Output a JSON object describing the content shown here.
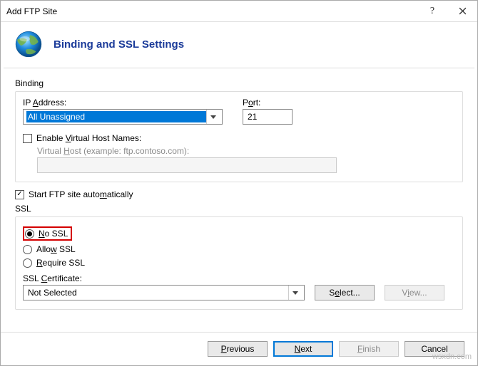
{
  "window": {
    "title": "Add FTP Site",
    "help_symbol": "?",
    "close_symbol": "×"
  },
  "header": {
    "title": "Binding and SSL Settings"
  },
  "binding": {
    "group_label": "Binding",
    "ip_label_pre": "IP ",
    "ip_label_u": "A",
    "ip_label_post": "ddress:",
    "ip_value": "All Unassigned",
    "port_label_pre": "P",
    "port_label_u": "o",
    "port_label_post": "rt:",
    "port_value": "21",
    "enable_vhost_pre": "Enable ",
    "enable_vhost_u": "V",
    "enable_vhost_post": "irtual Host Names:",
    "enable_vhost_checked": false,
    "vhost_label_pre": "Virtual ",
    "vhost_label_u": "H",
    "vhost_label_post": "ost (example: ftp.contoso.com):",
    "vhost_value": ""
  },
  "start": {
    "label_pre": "Start FTP site auto",
    "label_u": "m",
    "label_post": "atically",
    "checked": true
  },
  "ssl": {
    "group_label": "SSL",
    "no_ssl_u": "N",
    "no_ssl_post": "o SSL",
    "allow_pre": "Allo",
    "allow_u": "w",
    "allow_post": " SSL",
    "require_u": "R",
    "require_post": "equire SSL",
    "selected": "no",
    "cert_label_pre": "SSL ",
    "cert_label_u": "C",
    "cert_label_post": "ertificate:",
    "cert_value": "Not Selected",
    "select_btn_pre": "S",
    "select_btn_u": "e",
    "select_btn_post": "lect...",
    "view_btn_pre": "V",
    "view_btn_u": "i",
    "view_btn_post": "ew..."
  },
  "footer": {
    "previous_u": "P",
    "previous_post": "revious",
    "next_u": "N",
    "next_post": "ext",
    "finish_u": "F",
    "finish_post": "inish",
    "cancel": "Cancel"
  },
  "watermark": "wsxdn.com"
}
